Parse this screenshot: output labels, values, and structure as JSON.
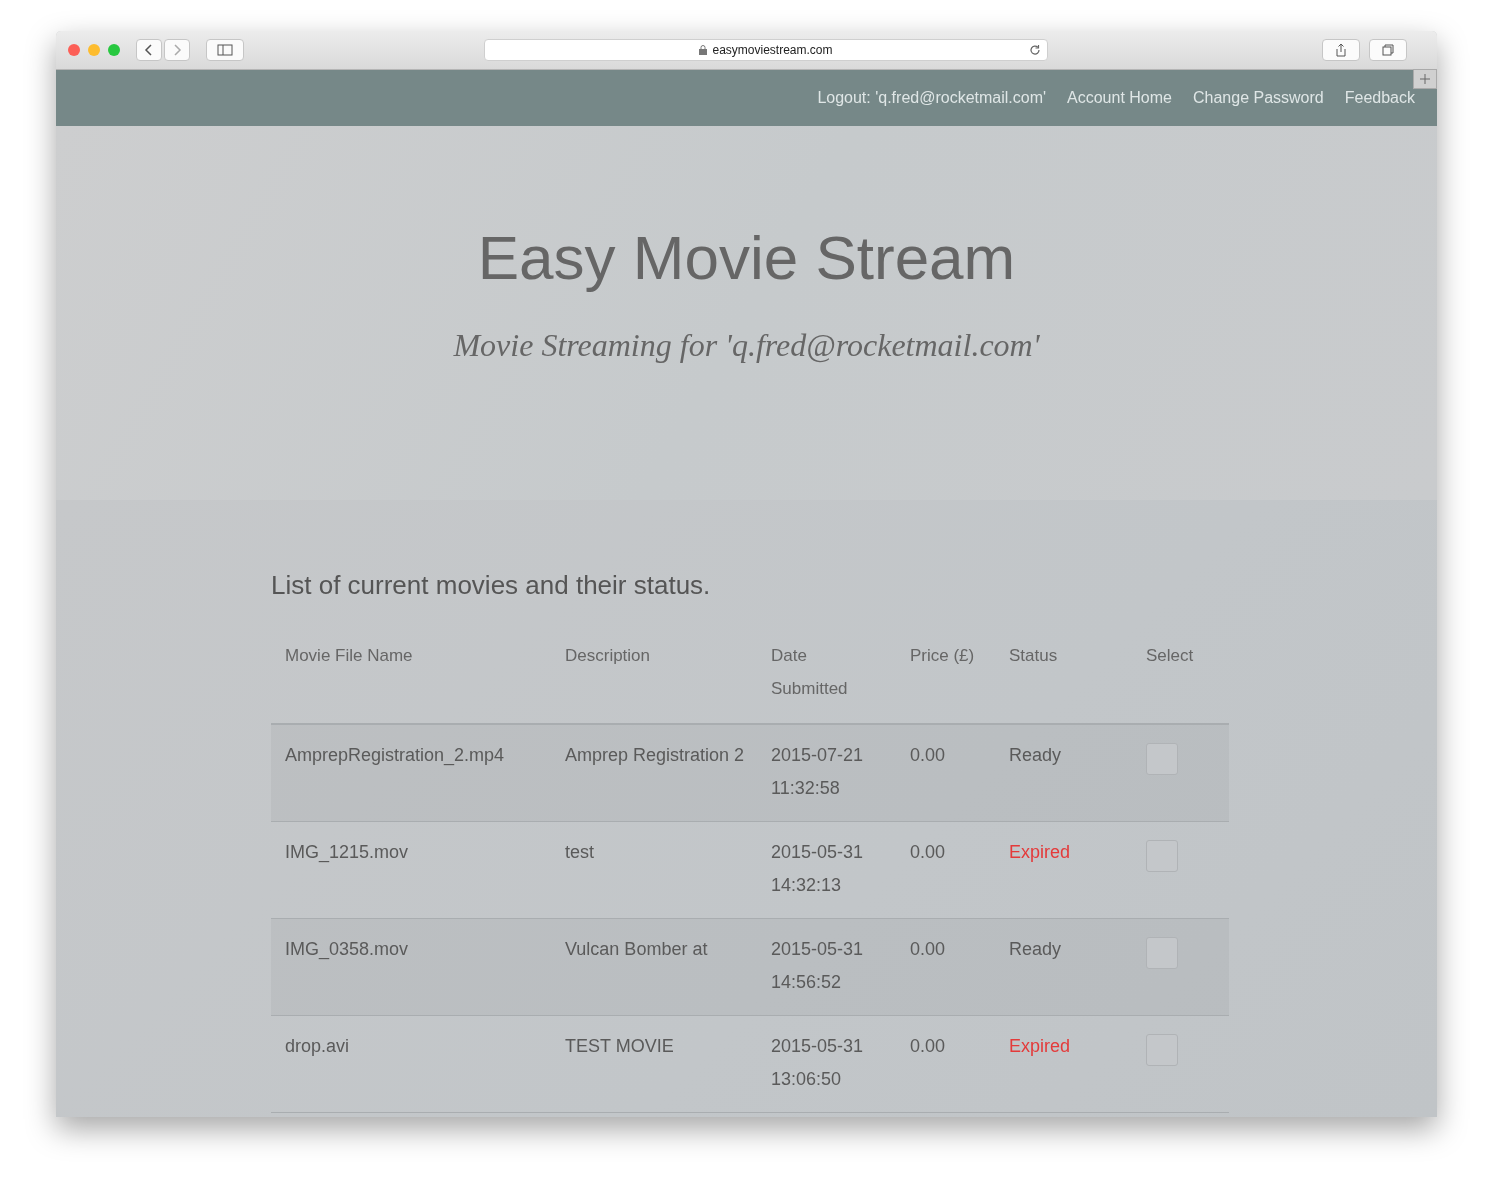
{
  "browser": {
    "url": "easymoviestream.com"
  },
  "nav": {
    "links": [
      "Logout: 'q.fred@rocketmail.com'",
      "Account Home",
      "Change Password",
      "Feedback"
    ]
  },
  "hero": {
    "title": "Easy Movie Stream",
    "subtitle": "Movie Streaming for 'q.fred@rocketmail.com'"
  },
  "table": {
    "caption": "List of current movies and their status.",
    "columns": [
      "Movie File Name",
      "Description",
      "Date Submitted",
      "Price (£)",
      "Status",
      "Select"
    ],
    "rows": [
      {
        "file": "AmprepRegistration_2.mp4",
        "description": "Amprep Registration 2",
        "date": "2015-07-21 11:32:58",
        "price": "0.00",
        "status": "Ready",
        "kind": "ready",
        "checked": false
      },
      {
        "file": "IMG_1215.mov",
        "description": "test",
        "date": "2015-05-31 14:32:13",
        "price": "0.00",
        "status": "Expired",
        "kind": "expired",
        "checked": false
      },
      {
        "file": "IMG_0358.mov",
        "description": "Vulcan Bomber at",
        "date": "2015-05-31 14:56:52",
        "price": "0.00",
        "status": "Ready",
        "kind": "ready",
        "checked": false
      },
      {
        "file": "drop.avi",
        "description": "TEST MOVIE",
        "date": "2015-05-31 13:06:50",
        "price": "0.00",
        "status": "Expired",
        "kind": "expired",
        "checked": false
      }
    ]
  }
}
